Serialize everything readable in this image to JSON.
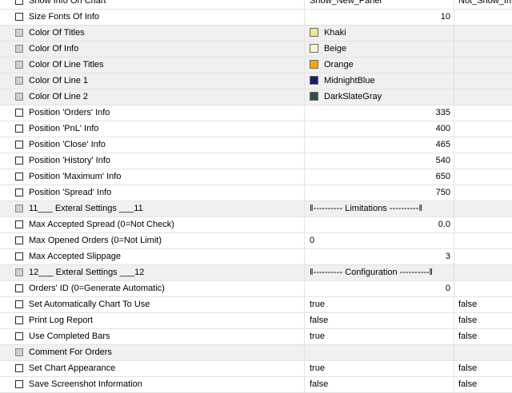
{
  "rows": [
    {
      "name": "Show Info On Chart",
      "kind": "text",
      "value": "Show_New_Panel",
      "alt": "Not_Show_Inf",
      "gray": false
    },
    {
      "name": "Size Fonts Of Info",
      "kind": "number",
      "value": "10",
      "gray": false
    },
    {
      "name": "Color Of Titles",
      "kind": "color",
      "value": "Khaki",
      "color": "#f0e68c",
      "gray": true
    },
    {
      "name": "Color Of Info",
      "kind": "color",
      "value": "Beige",
      "color": "#f5f5dc",
      "gray": true
    },
    {
      "name": "Color Of Line Titles",
      "kind": "color",
      "value": "Orange",
      "color": "#ffa500",
      "gray": true
    },
    {
      "name": "Color Of Line 1",
      "kind": "color",
      "value": "MidnightBlue",
      "color": "#191970",
      "gray": true
    },
    {
      "name": "Color Of Line 2",
      "kind": "color",
      "value": "DarkSlateGray",
      "color": "#2f4f4f",
      "gray": true
    },
    {
      "name": "Position 'Orders' Info",
      "kind": "number",
      "value": "335",
      "gray": false
    },
    {
      "name": "Position 'PnL' Info",
      "kind": "number",
      "value": "400",
      "gray": false
    },
    {
      "name": "Position 'Close' Info",
      "kind": "number",
      "value": "465",
      "gray": false
    },
    {
      "name": "Position 'History' Info",
      "kind": "number",
      "value": "540",
      "gray": false
    },
    {
      "name": "Position 'Maximum' Info",
      "kind": "number",
      "value": "650",
      "gray": false
    },
    {
      "name": "Position 'Spread' Info",
      "kind": "number",
      "value": "750",
      "gray": false
    },
    {
      "name": "11___ Exteral Settings ___11",
      "kind": "separator",
      "value": "‖---------- Limitations ----------‖",
      "gray": true
    },
    {
      "name": "Max Accepted Spread (0=Not Check)",
      "kind": "number",
      "value": "0.0",
      "gray": false
    },
    {
      "name": "Max Opened Orders (0=Not Limit)",
      "kind": "text",
      "value": "0",
      "gray": false
    },
    {
      "name": "Max Accepted Slippage",
      "kind": "number",
      "value": "3",
      "gray": false
    },
    {
      "name": "12___ Exteral Settings ___12",
      "kind": "separator",
      "value": "‖---------- Configuration ----------‖",
      "gray": true
    },
    {
      "name": "Orders' ID (0=Generate Automatic)",
      "kind": "number",
      "value": "0",
      "gray": false
    },
    {
      "name": "Set Automatically Chart To Use",
      "kind": "text",
      "value": "true",
      "alt": "false",
      "gray": false
    },
    {
      "name": "Print Log Report",
      "kind": "text",
      "value": "false",
      "alt": "false",
      "gray": false
    },
    {
      "name": "Use Completed Bars",
      "kind": "text",
      "value": "true",
      "alt": "false",
      "gray": false
    },
    {
      "name": "Comment For Orders",
      "kind": "text",
      "value": "",
      "gray": true
    },
    {
      "name": "Set Chart Appearance",
      "kind": "text",
      "value": "true",
      "alt": "false",
      "gray": false
    },
    {
      "name": "Save Screenshot Information",
      "kind": "text",
      "value": "false",
      "alt": "false",
      "gray": false
    }
  ]
}
